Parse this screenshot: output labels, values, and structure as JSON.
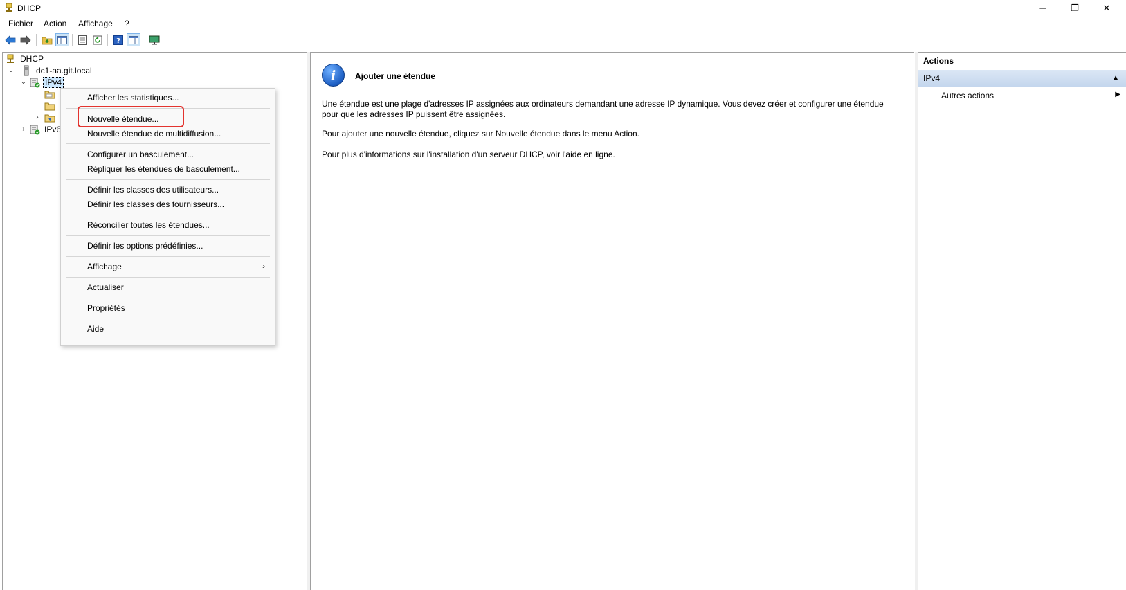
{
  "window": {
    "title": "DHCP",
    "minimize_glyph": "─",
    "maximize_glyph": "❐",
    "close_glyph": "✕"
  },
  "menubar": [
    "Fichier",
    "Action",
    "Affichage",
    "?"
  ],
  "toolbar": {
    "icons": [
      "back-arrow-icon",
      "forward-arrow-icon",
      "up-folder-icon",
      "show-hide-tree-icon",
      "export-list-icon",
      "refresh-icon",
      "help-icon",
      "show-hide-action-pane-icon",
      "monitor-icon"
    ]
  },
  "tree": {
    "root": "DHCP",
    "server": "dc1-aa.git.local",
    "ipv4": "IPv4",
    "child1": "C",
    "child2": "S",
    "child3": "I",
    "ipv6": "IPv6"
  },
  "context_menu": {
    "items": [
      "Afficher les statistiques...",
      "Nouvelle étendue...",
      "Nouvelle étendue de multidiffusion...",
      "Configurer un basculement...",
      "Répliquer les étendues de basculement...",
      "Définir les classes des utilisateurs...",
      "Définir les classes des fournisseurs...",
      "Réconcilier toutes les étendues...",
      "Définir les options prédéfinies...",
      "Affichage",
      "Actualiser",
      "Propriétés",
      "Aide"
    ],
    "submenu_arrow": "›",
    "highlighted_item": "Nouvelle étendue..."
  },
  "content": {
    "icon_glyph": "i",
    "title": "Ajouter une étendue",
    "para1": "Une étendue est une plage d'adresses IP assignées aux ordinateurs demandant une adresse IP dynamique. Vous devez créer et configurer une étendue pour que les adresses IP puissent être assignées.",
    "para2": "Pour ajouter une nouvelle étendue, cliquez sur Nouvelle étendue dans le menu Action.",
    "para3": "Pour plus d'informations sur l'installation d'un serveur DHCP, voir l'aide en ligne."
  },
  "actions": {
    "header": "Actions",
    "section": "IPv4",
    "section_arrow": "▲",
    "link": "Autres actions",
    "link_arrow": "▶"
  }
}
